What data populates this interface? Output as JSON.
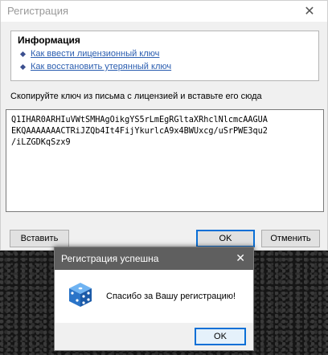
{
  "window": {
    "title": "Регистрация",
    "close_symbol": "✕"
  },
  "info": {
    "title": "Информация",
    "links": [
      "Как ввести лицензионный ключ",
      "Как восстановить утерянный ключ"
    ]
  },
  "instruction": "Скопируйте ключ из письма с лицензией и вставьте его сюда",
  "key": {
    "lines": [
      "Q1IHAR0ARHIuVWtSMHAgOikgYS5rLmEgRGltaXRhclNlcmcAAGUA",
      "EKQAAAAAAACTRiJZQb4It4FijYkurlcA9x4BWUxcg/uSrPWE3qu2",
      "/iLZGDKqSzx9"
    ]
  },
  "buttons": {
    "insert": "Вставить",
    "ok": "OK",
    "cancel": "Отменить"
  },
  "dialog": {
    "title": "Регистрация успешна",
    "close_symbol": "✕",
    "message": "Спасибо за Вашу регистрацию!",
    "ok": "OK",
    "icon": "dice-icon"
  }
}
